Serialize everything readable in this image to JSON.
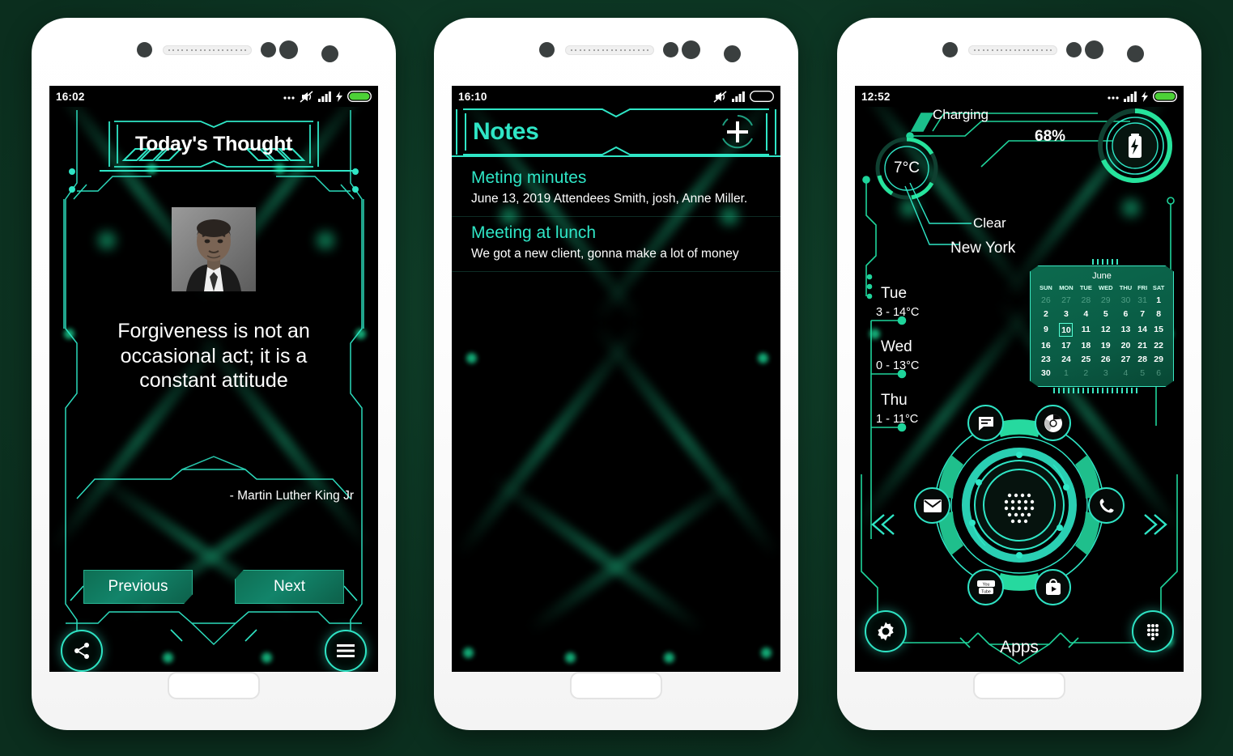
{
  "theme": {
    "accent": "#2fe6c6",
    "green": "#17c98b",
    "page_bg": "#0e3a26",
    "screen_bg": "#000000"
  },
  "phone1": {
    "status": {
      "time": "16:02",
      "icons": [
        "more-dots",
        "mute",
        "signal",
        "charging-bolt",
        "battery-full"
      ]
    },
    "header": {
      "title": "Today's Thought"
    },
    "portrait_alt": "martin-luther-king-portrait",
    "quote": "Forgiveness is not an occasional act; it is a constant attitude",
    "author": "- Martin Luther King Jr",
    "buttons": {
      "previous": "Previous",
      "next": "Next"
    },
    "fabs": {
      "share": "share-icon",
      "menu": "menu-icon"
    }
  },
  "phone2": {
    "status": {
      "time": "16:10",
      "icons": [
        "mute",
        "signal",
        "battery-empty"
      ]
    },
    "header": {
      "title": "Notes",
      "add_label": "+"
    },
    "notes": [
      {
        "title": "Meting minutes",
        "body": "June 13, 2019 Attendees Smith, josh, Anne Miller."
      },
      {
        "title": "Meeting at lunch",
        "body": "We got a new client, gonna make  a lot of money"
      }
    ]
  },
  "phone3": {
    "status": {
      "time": "12:52",
      "icons": [
        "more-dots",
        "signal",
        "charging-bolt",
        "battery-full"
      ]
    },
    "battery": {
      "state": "Charging",
      "percent": "68%",
      "icon": "battery-charging-icon"
    },
    "weather": {
      "current_temp": "7°C",
      "condition": "Clear",
      "city": "New York"
    },
    "forecast": [
      {
        "day": "Tue",
        "range": "3 - 14°C"
      },
      {
        "day": "Wed",
        "range": "0 - 13°C"
      },
      {
        "day": "Thu",
        "range": "1 - 11°C"
      }
    ],
    "calendar": {
      "month": "June",
      "weekdays": [
        "SUN",
        "MON",
        "TUE",
        "WED",
        "THU",
        "FRI",
        "SAT"
      ],
      "today": "10",
      "weeks": [
        [
          {
            "d": "26",
            "o": true
          },
          {
            "d": "27",
            "o": true
          },
          {
            "d": "28",
            "o": true
          },
          {
            "d": "29",
            "o": true
          },
          {
            "d": "30",
            "o": true
          },
          {
            "d": "31",
            "o": true
          },
          {
            "d": "1",
            "o": false
          }
        ],
        [
          {
            "d": "2",
            "o": false
          },
          {
            "d": "3",
            "o": false
          },
          {
            "d": "4",
            "o": false
          },
          {
            "d": "5",
            "o": false
          },
          {
            "d": "6",
            "o": false
          },
          {
            "d": "7",
            "o": false
          },
          {
            "d": "8",
            "o": false
          }
        ],
        [
          {
            "d": "9",
            "o": false
          },
          {
            "d": "10",
            "o": false
          },
          {
            "d": "11",
            "o": false
          },
          {
            "d": "12",
            "o": false
          },
          {
            "d": "13",
            "o": false
          },
          {
            "d": "14",
            "o": false
          },
          {
            "d": "15",
            "o": false
          }
        ],
        [
          {
            "d": "16",
            "o": false
          },
          {
            "d": "17",
            "o": false
          },
          {
            "d": "18",
            "o": false
          },
          {
            "d": "19",
            "o": false
          },
          {
            "d": "20",
            "o": false
          },
          {
            "d": "21",
            "o": false
          },
          {
            "d": "22",
            "o": false
          }
        ],
        [
          {
            "d": "23",
            "o": false
          },
          {
            "d": "24",
            "o": false
          },
          {
            "d": "25",
            "o": false
          },
          {
            "d": "26",
            "o": false
          },
          {
            "d": "27",
            "o": false
          },
          {
            "d": "28",
            "o": false
          },
          {
            "d": "29",
            "o": false
          }
        ],
        [
          {
            "d": "30",
            "o": false
          },
          {
            "d": "1",
            "o": true
          },
          {
            "d": "2",
            "o": true
          },
          {
            "d": "3",
            "o": true
          },
          {
            "d": "4",
            "o": true
          },
          {
            "d": "5",
            "o": true
          },
          {
            "d": "6",
            "o": true
          }
        ]
      ]
    },
    "dock": {
      "apps_label": "Apps",
      "icons": [
        "messages-icon",
        "chrome-icon",
        "email-icon",
        "phone-icon",
        "youtube-icon",
        "play-store-icon"
      ],
      "left_arrow": "chevron-double-left-icon",
      "right_arrow": "chevron-double-right-icon",
      "settings": "gear-icon",
      "app_drawer": "app-drawer-icon"
    }
  }
}
